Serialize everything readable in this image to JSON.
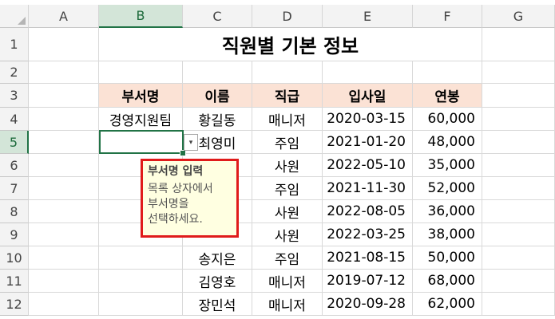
{
  "columns": [
    "A",
    "B",
    "C",
    "D",
    "E",
    "F",
    "G"
  ],
  "rows": [
    "1",
    "2",
    "3",
    "4",
    "5",
    "6",
    "7",
    "8",
    "9",
    "10",
    "11",
    "12"
  ],
  "title": "직원별 기본 정보",
  "table": {
    "headers": [
      "부서명",
      "이름",
      "직급",
      "입사일",
      "연봉"
    ],
    "rows": [
      [
        "경영지원팀",
        "황길동",
        "매니저",
        "2020-03-15",
        "60,000"
      ],
      [
        "",
        "최영미",
        "주임",
        "2021-01-20",
        "48,000"
      ],
      [
        "",
        "",
        "사원",
        "2022-05-10",
        "35,000"
      ],
      [
        "",
        "",
        "주임",
        "2021-11-30",
        "52,000"
      ],
      [
        "",
        "",
        "사원",
        "2022-08-05",
        "36,000"
      ],
      [
        "",
        "",
        "사원",
        "2022-03-25",
        "38,000"
      ],
      [
        "",
        "송지은",
        "주임",
        "2021-08-15",
        "50,000"
      ],
      [
        "",
        "김영호",
        "매니저",
        "2019-07-12",
        "68,000"
      ],
      [
        "",
        "장민석",
        "매니저",
        "2020-09-28",
        "62,000"
      ]
    ]
  },
  "active_cell": "B5",
  "validation_tooltip": {
    "title": "부서명 입력",
    "message": "목록 상자에서\n부서명을\n선택하세요."
  },
  "colors": {
    "header_fill": "#fbe2d5",
    "selection": "#217346",
    "highlight_border": "#e01b1b",
    "tooltip_bg": "#ffffe1"
  }
}
